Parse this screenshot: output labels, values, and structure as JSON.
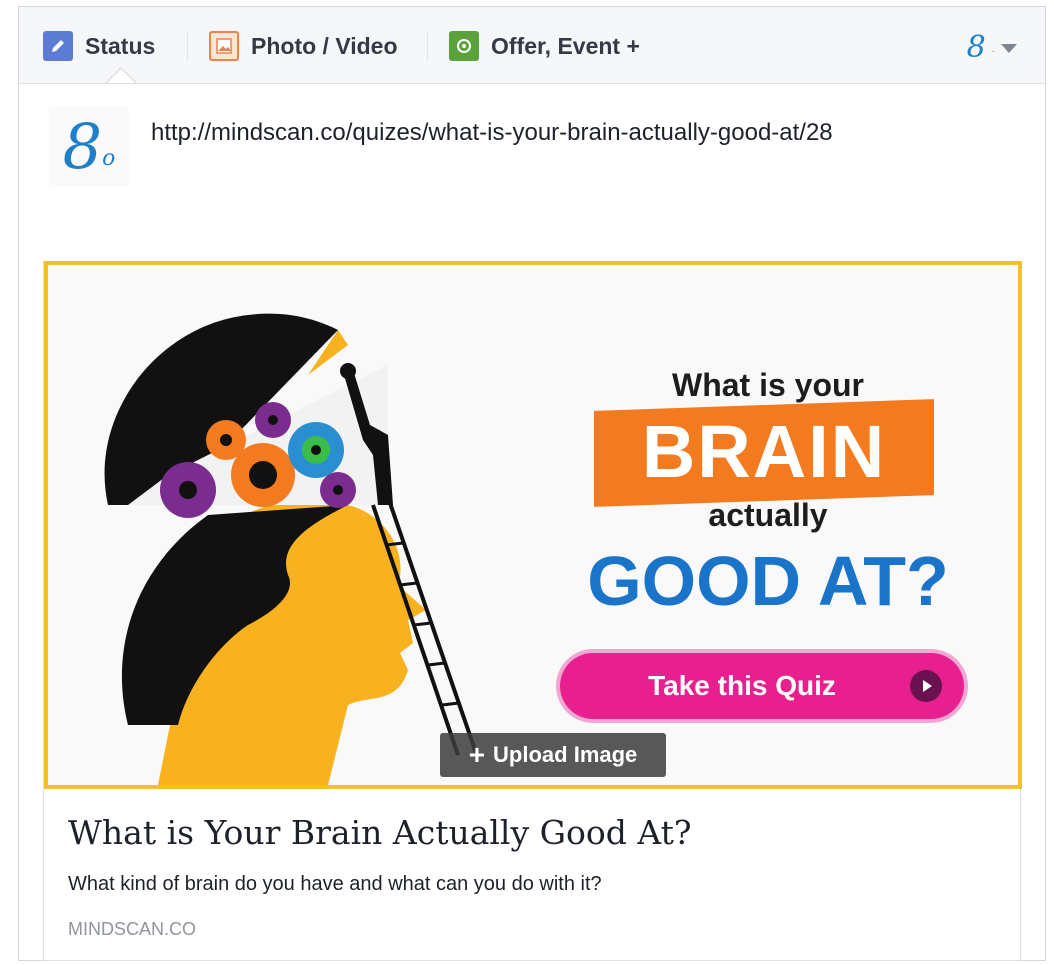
{
  "tabs": [
    {
      "label": "Status",
      "icon": "pencil-icon"
    },
    {
      "label": "Photo / Video",
      "icon": "photo-icon"
    },
    {
      "label": "Offer, Event +",
      "icon": "offer-icon"
    }
  ],
  "audience": {
    "icon": "page-logo-icon",
    "suffix": "."
  },
  "post": {
    "avatar_letter": "8",
    "avatar_sub": "o",
    "url": "http://mindscan.co/quizes/what-is-your-brain-actually-good-at/28"
  },
  "preview": {
    "image": {
      "line1": "What is your",
      "line2": "BRAIN",
      "line3": "actually",
      "line4": "GOOD AT?",
      "button": "Take this Quiz"
    },
    "upload_plus": "+",
    "upload_label": "Upload Image",
    "title": "What is Your Brain Actually Good At?",
    "description": "What kind of brain do you have and what can you do with it?",
    "domain": "MINDSCAN.CO"
  },
  "colors": {
    "accent_blue": "#1f7fc9",
    "frame_yellow": "#f4bf2a",
    "banner_orange": "#f47a1f",
    "button_pink": "#e8208f",
    "head_yellow": "#f9b21f"
  }
}
